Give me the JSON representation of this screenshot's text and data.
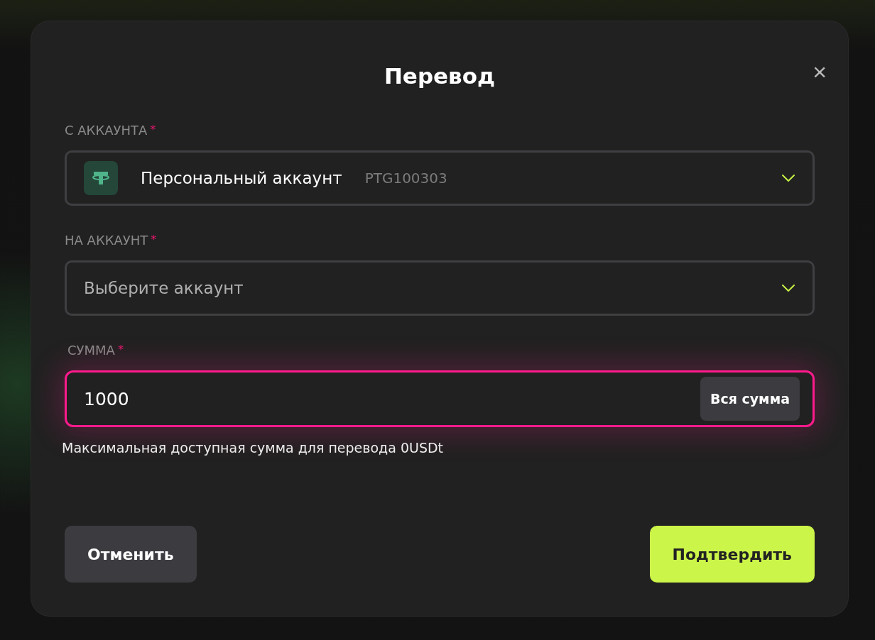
{
  "dialog": {
    "title": "Перевод",
    "close": "×",
    "fields": [
      {
        "kind": "select",
        "label": "С АККАУНТА",
        "required_mark": "*",
        "value": "Персональный аккаунт",
        "account_id": "PTG100303",
        "has_coin_icon": true,
        "focused": false
      },
      {
        "kind": "select",
        "label": "НА АККАУНТ",
        "required_mark": "*",
        "placeholder": "Выберите аккаунт",
        "focused": false
      },
      {
        "kind": "amount",
        "label": "СУММА",
        "required_mark": "*",
        "value": "1000",
        "action": "Вся сумма",
        "hint": "Максимальная доступная сумма для перевода 0USDt",
        "focused": true
      }
    ],
    "buttons": [
      {
        "label": "Отменить",
        "kind": "secondary"
      },
      {
        "label": "Подтвердить",
        "kind": "primary"
      }
    ]
  }
}
